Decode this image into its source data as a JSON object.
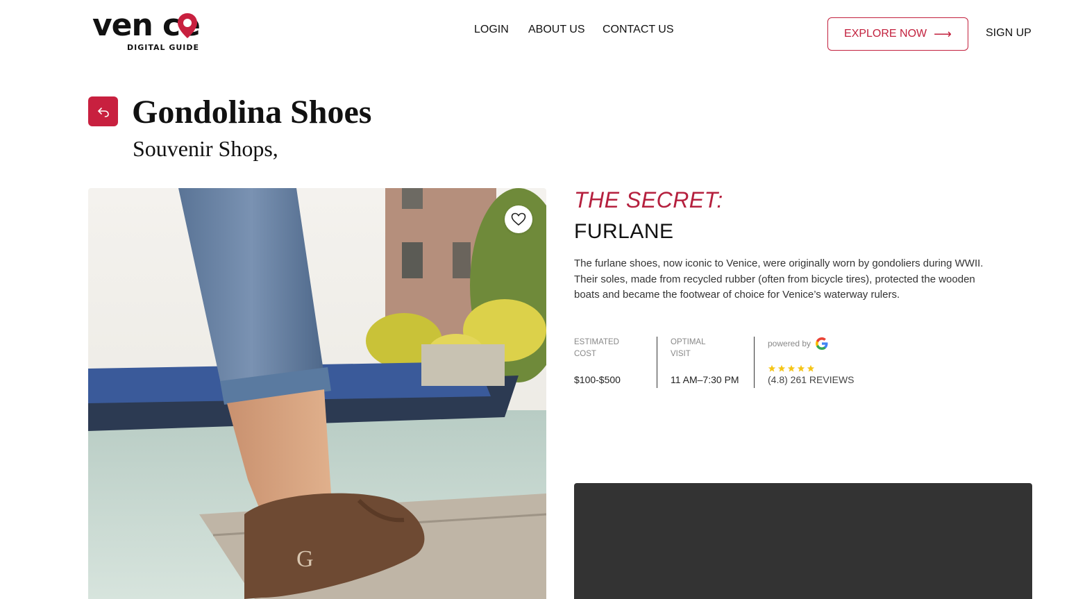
{
  "header": {
    "logo_word": "venice",
    "logo_sub": "DIGITAL GUIDE",
    "nav": [
      "LOGIN",
      "ABOUT US",
      "CONTACT US"
    ],
    "explore_label": "EXPLORE NOW",
    "signup_label": "SIGN UP"
  },
  "place": {
    "title": "Gondolina Shoes",
    "category": "Souvenir Shops,"
  },
  "secret": {
    "label": "THE SECRET:",
    "name": "FURLANE",
    "description": "The furlane shoes, now iconic to Venice, were originally worn by gondoliers during WWII. Their soles, made from recycled rubber (often from bicycle tires), protected the wooden boats and became the footwear of choice for Venice’s waterway rulers."
  },
  "stats": {
    "cost_label": "ESTIMATED COST",
    "cost_value": "$100-$500",
    "visit_label": "OPTIMAL VISIT",
    "visit_value": "11 AM–7:30 PM",
    "powered_label": "powered by",
    "rating": 4.8,
    "stars": 5,
    "reviews_text": "(4.8) 261 REVIEWS"
  },
  "icons": {
    "back": "back-arrow-icon",
    "heart": "heart-icon",
    "google": "google-icon",
    "explore_arrow": "arrow-right-icon"
  },
  "colors": {
    "accent": "#c2203d",
    "map_bg": "#333333",
    "star": "#f5c518"
  }
}
